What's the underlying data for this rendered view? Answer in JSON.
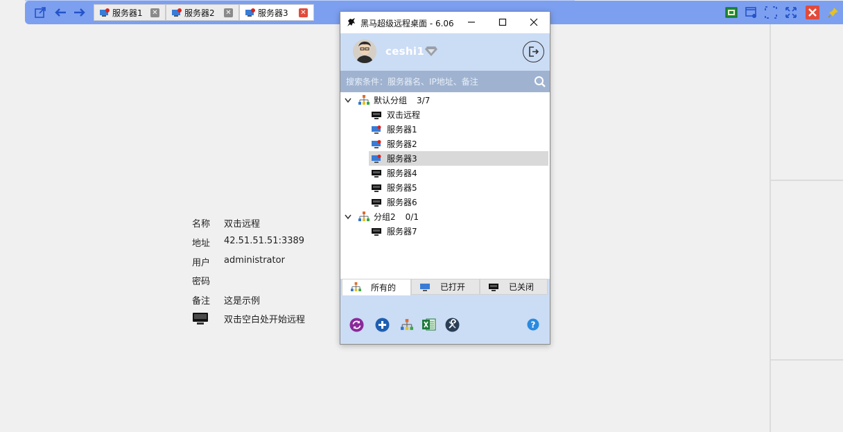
{
  "tabs": [
    {
      "label": "服务器1",
      "active": false
    },
    {
      "label": "服务器2",
      "active": false
    },
    {
      "label": "服务器3",
      "active": true
    }
  ],
  "info": {
    "rows": [
      {
        "key": "名称",
        "value": "双击远程"
      },
      {
        "key": "地址",
        "value": "42.51.51.51:3389"
      },
      {
        "key": "用户",
        "value": "administrator"
      },
      {
        "key": "密码",
        "value": ""
      },
      {
        "key": "备注",
        "value": "这是示例"
      }
    ],
    "hint": "双击空白处开始远程"
  },
  "window": {
    "title": "黑马超级远程桌面 - 6.06",
    "username": "ceshi1",
    "search_placeholder": "搜索条件：服务器名、IP地址、备注",
    "groups": [
      {
        "name": "默认分组",
        "count": "3/7",
        "items": [
          {
            "label": "双击远程",
            "status": "offline"
          },
          {
            "label": "服务器1",
            "status": "open"
          },
          {
            "label": "服务器2",
            "status": "open"
          },
          {
            "label": "服务器3",
            "status": "open",
            "selected": true
          },
          {
            "label": "服务器4",
            "status": "offline"
          },
          {
            "label": "服务器5",
            "status": "offline"
          },
          {
            "label": "服务器6",
            "status": "offline"
          }
        ]
      },
      {
        "name": "分组2",
        "count": "0/1",
        "items": [
          {
            "label": "服务器7",
            "status": "offline"
          }
        ]
      }
    ],
    "bottom_tabs": [
      "所有的",
      "已打开",
      "已关闭"
    ],
    "toolbar_icons": [
      "refresh-icon",
      "add-icon",
      "group-icon",
      "excel-icon",
      "settings-icon",
      "help-icon"
    ]
  },
  "colors": {
    "toolbar_bg": "#7c9ff0",
    "panel_bg": "#cbdcf5",
    "search_bg": "#9fb3d1",
    "close_active": "#e14b3b"
  }
}
